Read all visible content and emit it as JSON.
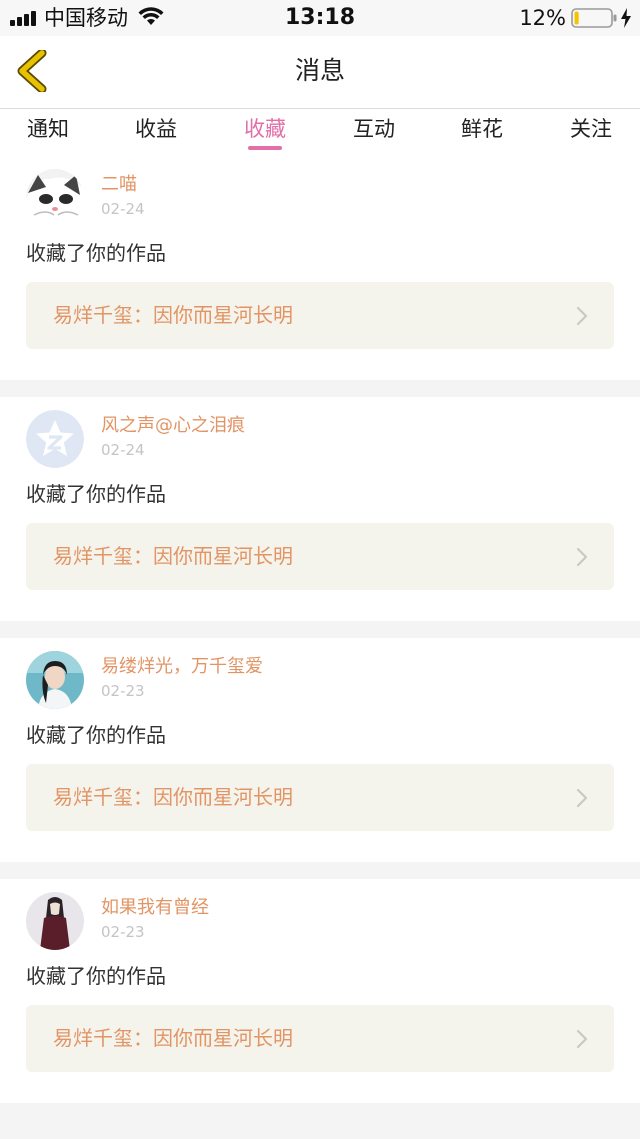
{
  "status_bar": {
    "carrier": "中国移动",
    "time": "13:18",
    "battery_percent": "12%",
    "battery_level": 0.12,
    "battery_color": "#f5c400"
  },
  "navbar": {
    "title": "消息",
    "back_icon": "chevron-left-icon",
    "back_color": "#e8c200"
  },
  "tabs": [
    {
      "label": "通知",
      "active": false
    },
    {
      "label": "收益",
      "active": false
    },
    {
      "label": "收藏",
      "active": true
    },
    {
      "label": "互动",
      "active": false
    },
    {
      "label": "鲜花",
      "active": false
    },
    {
      "label": "关注",
      "active": false
    }
  ],
  "colors": {
    "accent_pink": "#e26fa8",
    "name_orange": "#e29464",
    "work_bg": "#f4f4ec"
  },
  "notifications": [
    {
      "username": "二喵",
      "date": "02-24",
      "action": "收藏了你的作品",
      "work_title": "易烊千玺：因你而星河长明",
      "avatar": "cat-avatar"
    },
    {
      "username": "风之声@心之泪痕",
      "date": "02-24",
      "action": "收藏了你的作品",
      "work_title": "易烊千玺：因你而星河长明",
      "avatar": "default-star-avatar"
    },
    {
      "username": "易缕烊光，万千玺爱",
      "date": "02-23",
      "action": "收藏了你的作品",
      "work_title": "易烊千玺：因你而星河长明",
      "avatar": "person-avatar"
    },
    {
      "username": "如果我有曾经",
      "date": "02-23",
      "action": "收藏了你的作品",
      "work_title": "易烊千玺：因你而星河长明",
      "avatar": "figure-avatar"
    }
  ]
}
